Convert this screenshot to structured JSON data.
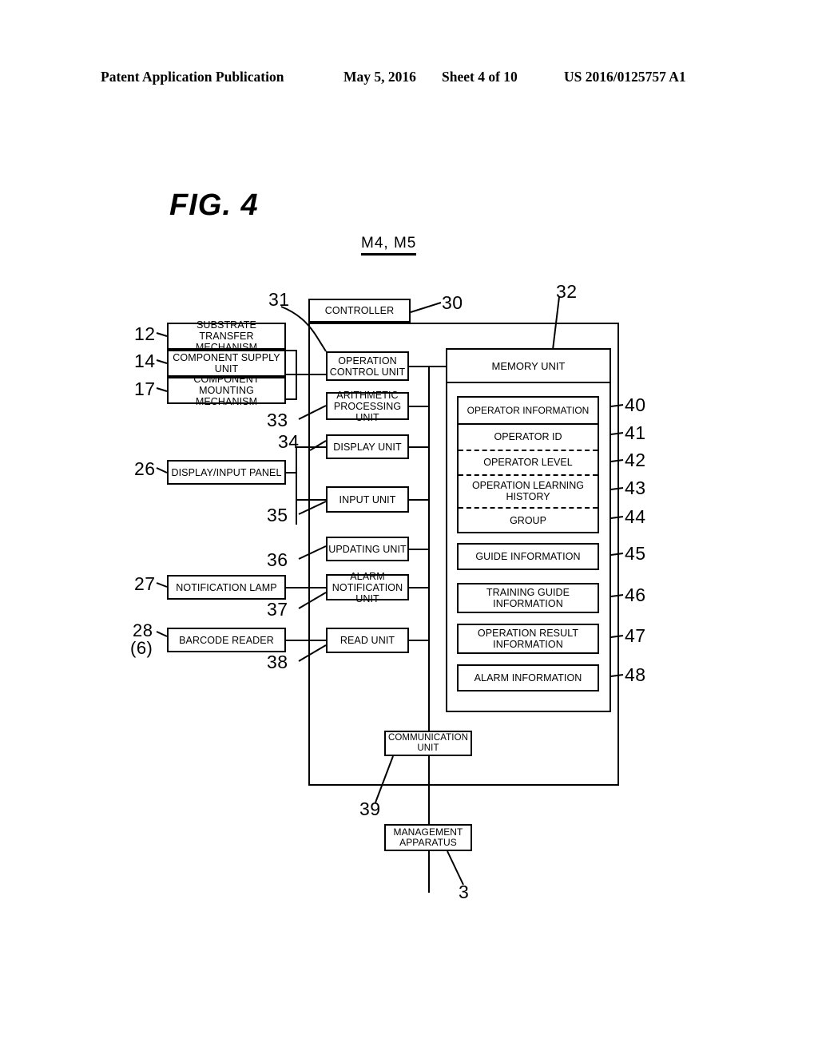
{
  "header": {
    "publication": "Patent Application Publication",
    "date": "May 5, 2016",
    "sheet": "Sheet 4 of 10",
    "number": "US 2016/0125757 A1"
  },
  "figure": {
    "title": "FIG. 4",
    "subject": "M4, M5"
  },
  "blocks": {
    "controller": "CONTROLLER",
    "substrate_transfer_mechanism": "SUBSTRATE TRANSFER MECHANISM",
    "component_supply_unit": "COMPONENT SUPPLY UNIT",
    "component_mounting_mechanism": "COMPONENT MOUNTING MECHANISM",
    "display_input_panel": "DISPLAY/INPUT PANEL",
    "notification_lamp": "NOTIFICATION LAMP",
    "barcode_reader": "BARCODE READER",
    "operation_control_unit": "OPERATION CONTROL UNIT",
    "arithmetic_processing_unit": "ARITHMETIC PROCESSING UNIT",
    "display_unit": "DISPLAY UNIT",
    "input_unit": "INPUT UNIT",
    "updating_unit": "UPDATING UNIT",
    "alarm_notification_unit": "ALARM NOTIFICATION UNIT",
    "read_unit": "READ UNIT",
    "communication_unit": "COMMUNICATION UNIT",
    "management_apparatus": "MANAGEMENT APPARATUS",
    "memory_unit": "MEMORY UNIT",
    "operator_information": "OPERATOR INFORMATION",
    "operator_id": "OPERATOR ID",
    "operator_level": "OPERATOR LEVEL",
    "operation_learning_history": "OPERATION LEARNING HISTORY",
    "group": "GROUP",
    "guide_information": "GUIDE INFORMATION",
    "training_guide_information": "TRAINING GUIDE INFORMATION",
    "operation_result_information": "OPERATION RESULT INFORMATION",
    "alarm_information": "ALARM INFORMATION"
  },
  "refs": {
    "n3": "3",
    "n12": "12",
    "n14": "14",
    "n17": "17",
    "n26": "26",
    "n27": "27",
    "n28": "28",
    "n28b": "(6)",
    "n30": "30",
    "n31": "31",
    "n32": "32",
    "n33": "33",
    "n34": "34",
    "n35": "35",
    "n36": "36",
    "n37": "37",
    "n38": "38",
    "n39": "39",
    "n40": "40",
    "n41": "41",
    "n42": "42",
    "n43": "43",
    "n44": "44",
    "n45": "45",
    "n46": "46",
    "n47": "47",
    "n48": "48"
  }
}
